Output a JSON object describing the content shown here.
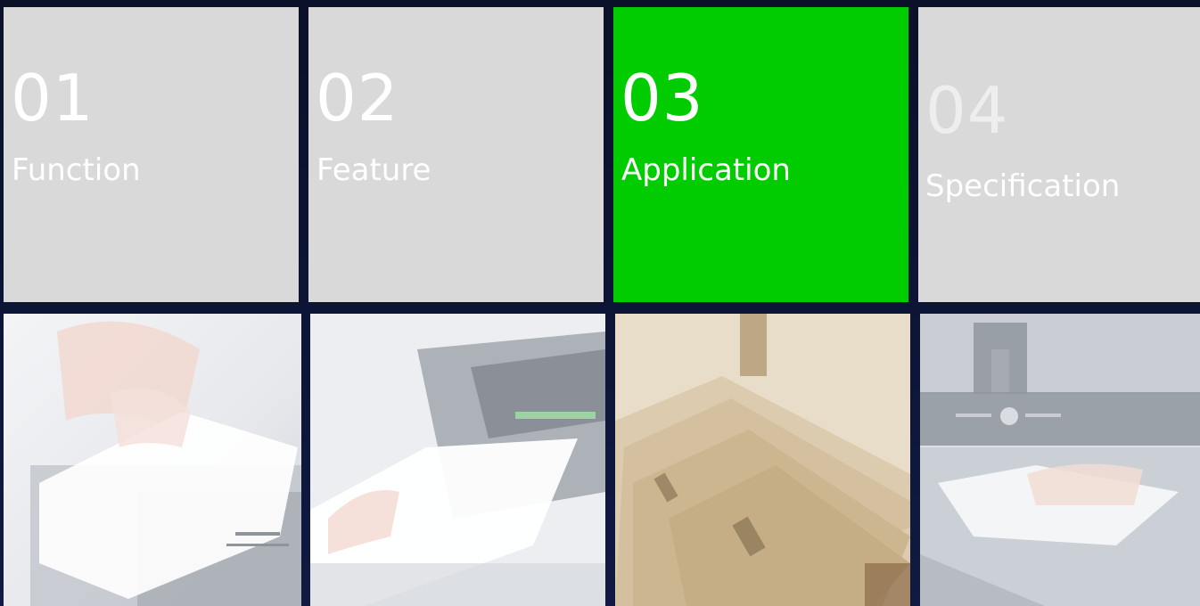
{
  "tabs": [
    {
      "number": "01",
      "label": "Function",
      "active": false
    },
    {
      "number": "02",
      "label": "Feature",
      "active": false
    },
    {
      "number": "03",
      "label": "Application",
      "active": true
    },
    {
      "number": "04",
      "label": "Specification",
      "active": false
    }
  ],
  "colors": {
    "background": "#0b1230",
    "tile_inactive": "#d9d9d9",
    "tile_active": "#00cc00",
    "text": "#ffffff"
  },
  "photos": [
    {
      "subject": "hand-inserting-paper-photo"
    },
    {
      "subject": "paper-feeding-device-photo"
    },
    {
      "subject": "stack-of-tickets-photo"
    },
    {
      "subject": "document-on-scanner-photo"
    }
  ]
}
